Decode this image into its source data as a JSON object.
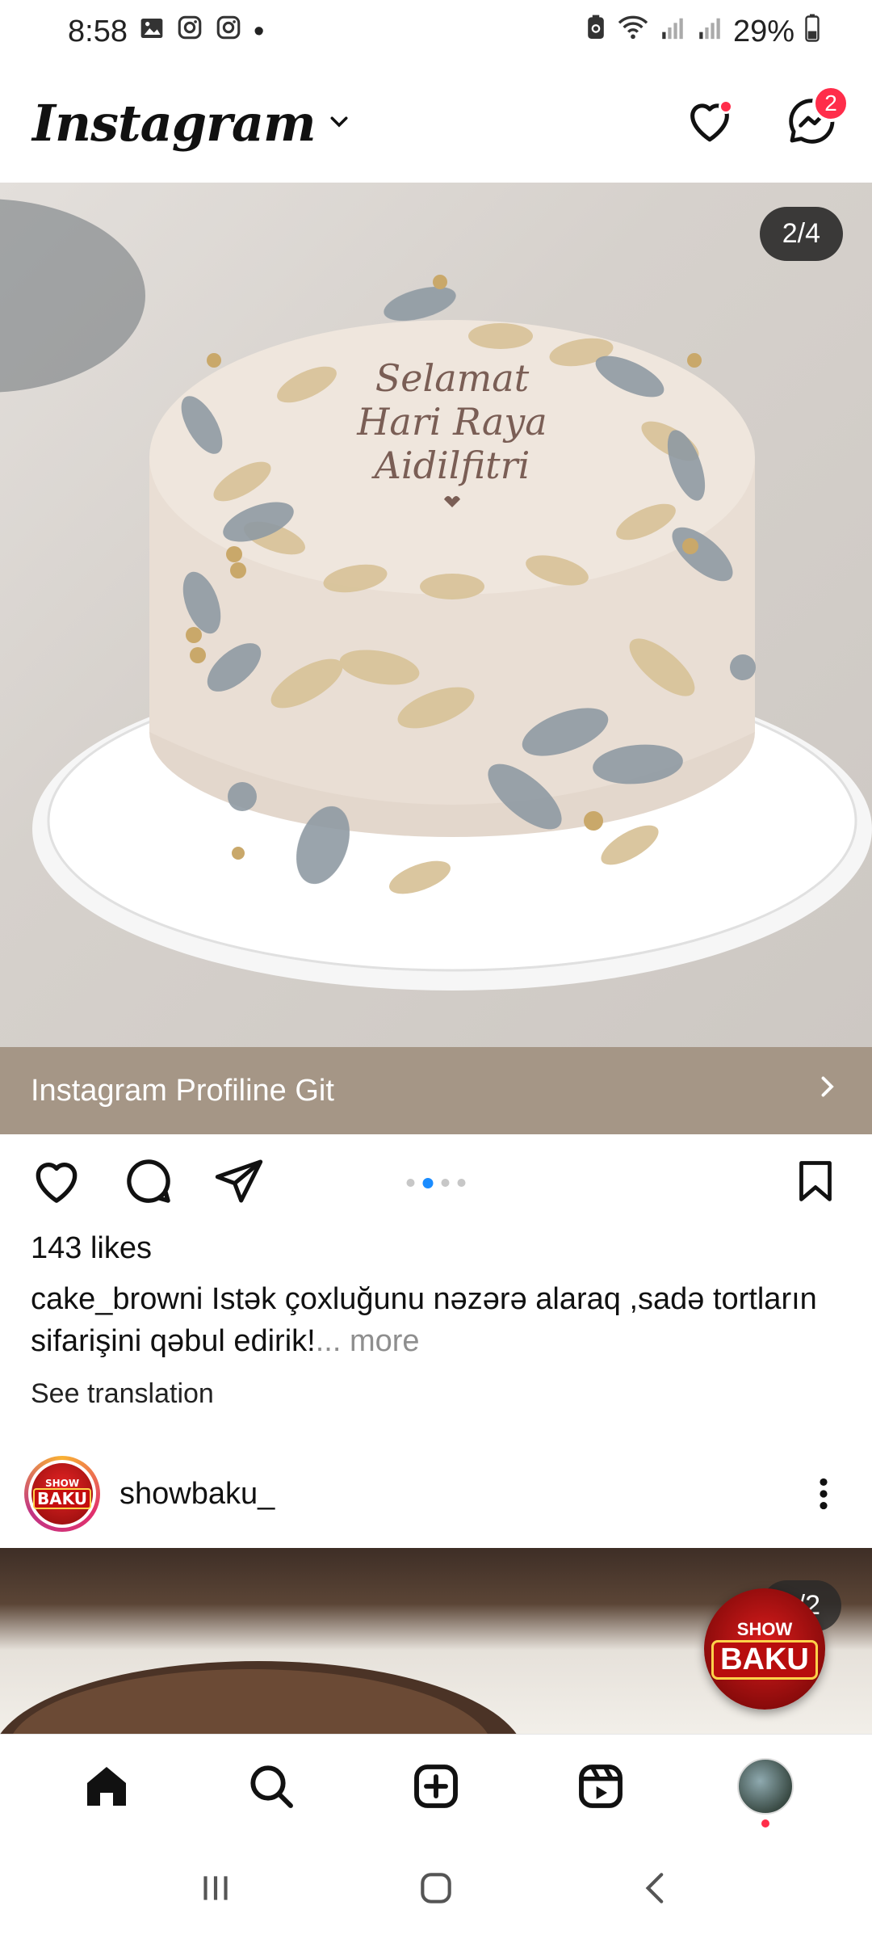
{
  "status_bar": {
    "time": "8:58",
    "notif_dot": "•",
    "battery": "29%"
  },
  "header": {
    "logo": "Instagram",
    "messages_count": "2"
  },
  "post": {
    "image_counter": "2/4",
    "cake_text_line1": "Selamat",
    "cake_text_line2": "Hari Raya",
    "cake_text_line3": "Aidilfitri",
    "cta_label": "Instagram Profiline Git",
    "likes": "143 likes",
    "caption_user": "cake_browni",
    "caption_text": " Istək çoxluğunu nəzərə alaraq ,sadə tortların sifarişini qəbul edirik!",
    "caption_more": "... more",
    "see_translation": "See translation",
    "carousel_active_index": 1,
    "carousel_total": 4
  },
  "next_post": {
    "username": "showbaku_",
    "avatar_show": "SHOW",
    "avatar_baku": "BAKU",
    "image_counter": "1/2",
    "badge_show": "SHOW",
    "badge_baku": "BAKU"
  },
  "colors": {
    "accent_blue": "#1a8cff",
    "badge_red": "#ff2d4a",
    "cta_bg": "#a59686"
  }
}
